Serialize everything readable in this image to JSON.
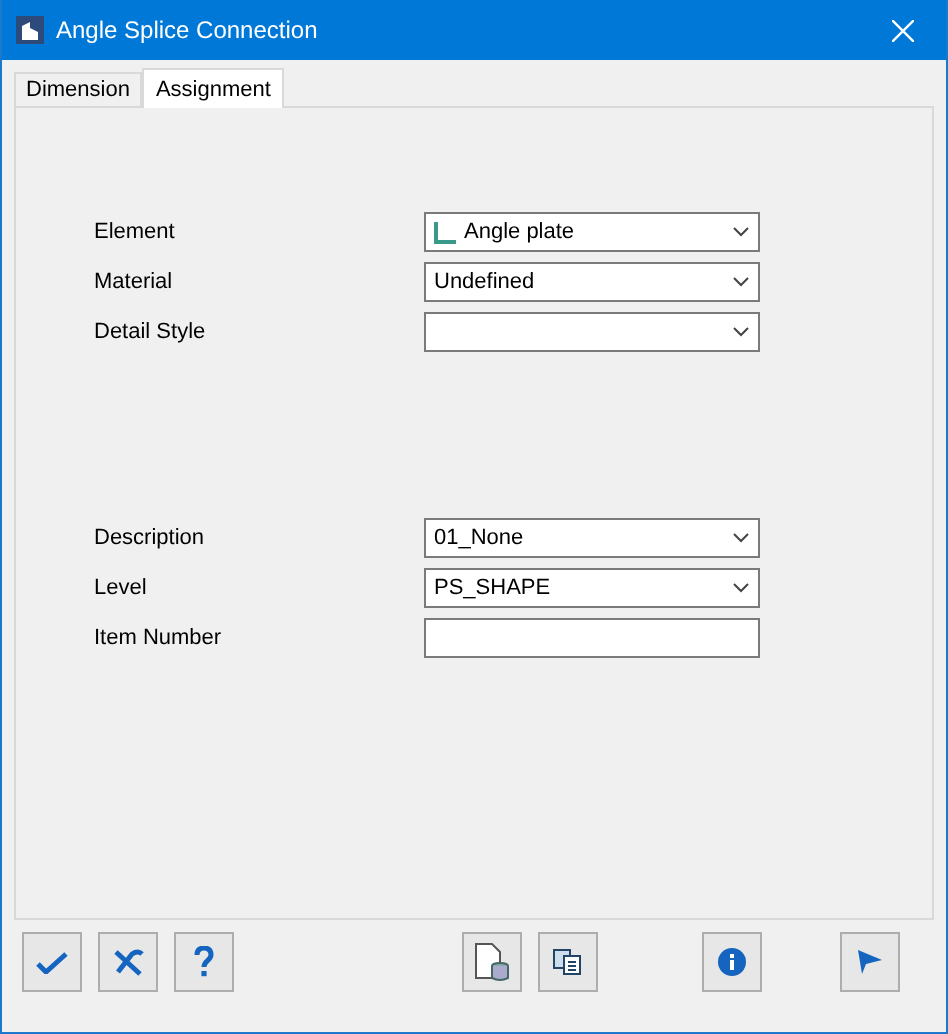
{
  "window": {
    "title": "Angle Splice Connection"
  },
  "tabs": [
    {
      "label": "Dimension",
      "selected": false
    },
    {
      "label": "Assignment",
      "selected": true
    }
  ],
  "groups": [
    {
      "fields": [
        {
          "label": "Element",
          "kind": "dropdown",
          "value": "Angle plate",
          "icon": true
        },
        {
          "label": "Material",
          "kind": "dropdown",
          "value": "Undefined"
        },
        {
          "label": "Detail Style",
          "kind": "dropdown"
        }
      ]
    },
    {
      "fields": [
        {
          "label": "Description",
          "kind": "dropdown",
          "value": "01_None"
        },
        {
          "label": "Level",
          "kind": "dropdown",
          "value": "PS_SHAPE"
        },
        {
          "label": "Item Number",
          "kind": "text"
        }
      ]
    }
  ]
}
